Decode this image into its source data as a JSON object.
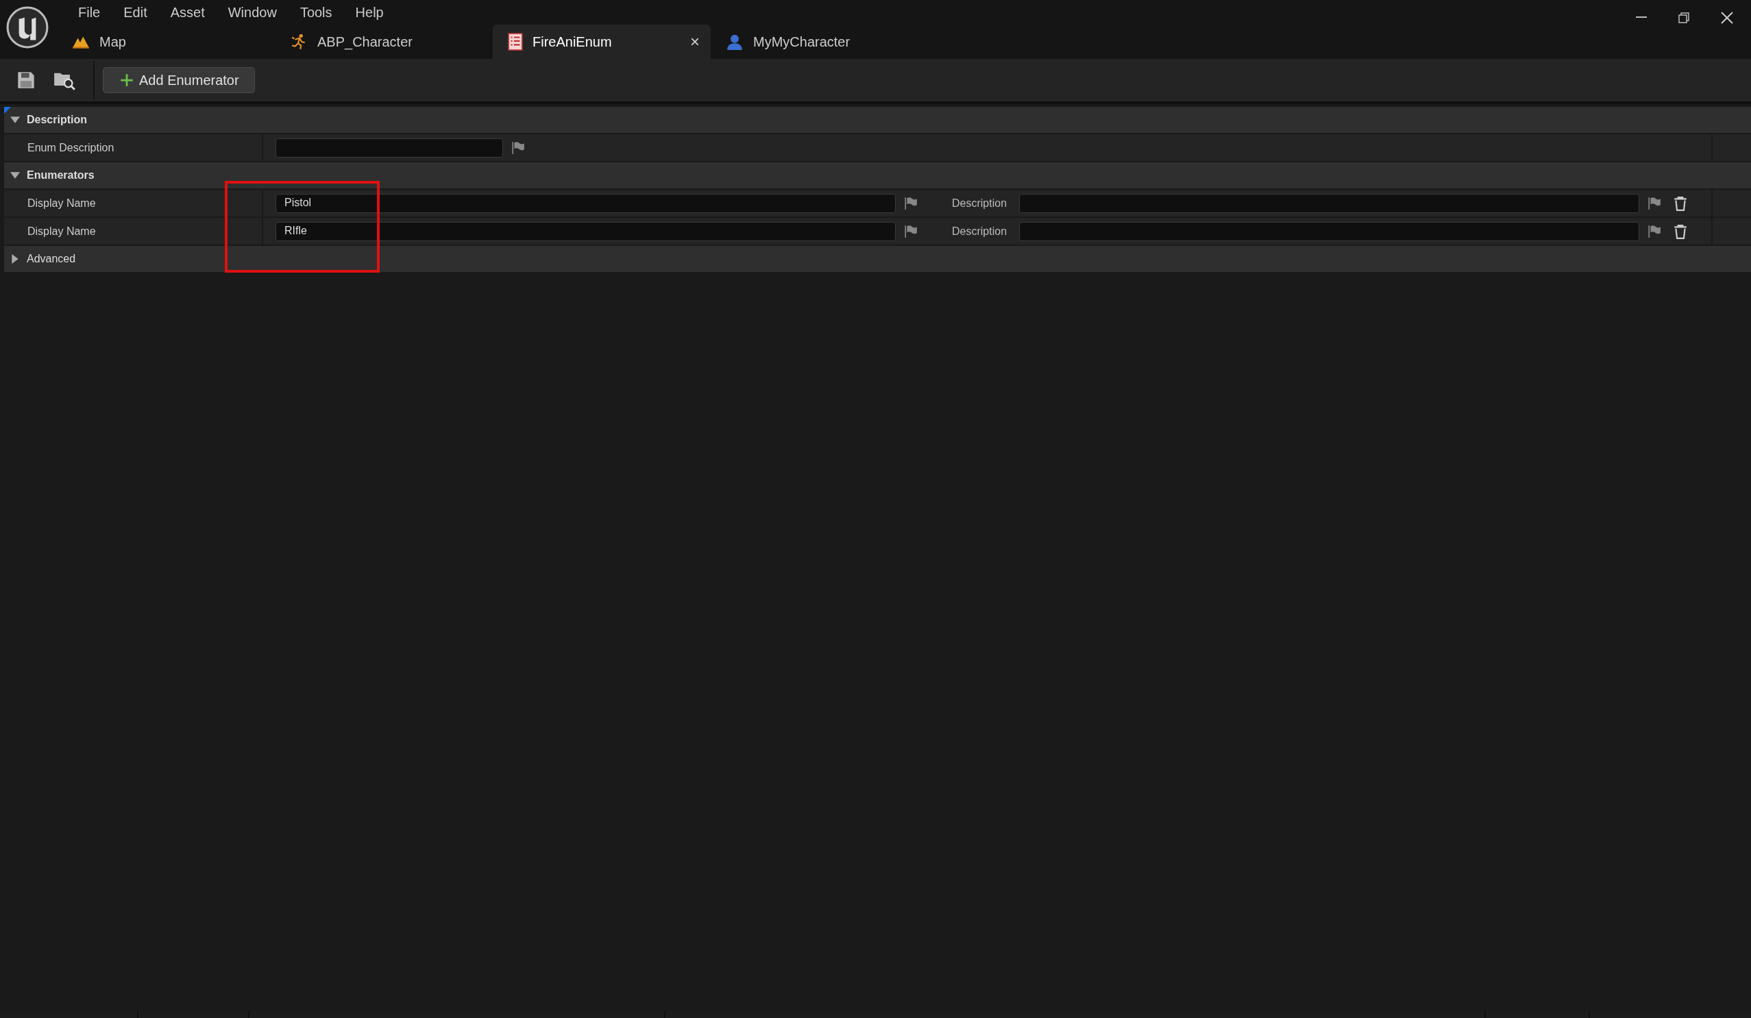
{
  "menu": [
    "File",
    "Edit",
    "Asset",
    "Window",
    "Tools",
    "Help"
  ],
  "tabs": [
    {
      "label": "Map",
      "selected": false
    },
    {
      "label": "ABP_Character",
      "selected": false
    },
    {
      "label": "FireAniEnum",
      "selected": true,
      "close": "×"
    },
    {
      "label": "MyMyCharacter",
      "selected": false
    }
  ],
  "toolbar": {
    "add_button": "Add Enumerator"
  },
  "sections": [
    {
      "title": "Description",
      "expanded": true,
      "rows": [
        {
          "kind": "text",
          "label": "Enum Description"
        }
      ]
    },
    {
      "title": "Enumerators",
      "expanded": true,
      "rows": [
        {
          "kind": "enumerator",
          "label": "Display Name",
          "value": "Pistol",
          "description_label": "Description"
        },
        {
          "kind": "enumerator",
          "label": "Display Name",
          "value": "RIfle",
          "description_label": "Description"
        }
      ]
    },
    {
      "title": "Advanced",
      "expanded": false
    }
  ]
}
